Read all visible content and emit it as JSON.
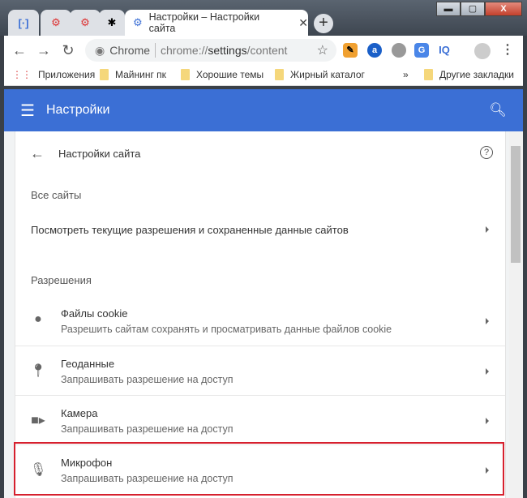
{
  "tabs": [
    {
      "icon": "bracket-icon"
    },
    {
      "icon": "gear-wrench-icon"
    },
    {
      "icon": "gear-wrench-icon"
    },
    {
      "icon": "puzzle-icon"
    },
    {
      "label": "Настройки – Настройки сайта",
      "icon": "settings-gear-icon",
      "active": true
    }
  ],
  "omnibox": {
    "site": "Chrome",
    "url_prefix": "chrome://",
    "url_host": "settings",
    "url_path": "/content"
  },
  "extensions": [
    "IQ"
  ],
  "bookmarks": {
    "apps": "Приложения",
    "items": [
      "Майнинг пк",
      "Хорошие темы",
      "Жирный каталог"
    ],
    "overflow": "»",
    "other": "Другие закладки"
  },
  "header": {
    "title": "Настройки"
  },
  "page": {
    "title": "Настройки сайта",
    "all_sites_heading": "Все сайты",
    "all_sites_link": "Посмотреть текущие разрешения и сохраненные данные сайтов",
    "permissions_heading": "Разрешения"
  },
  "permissions": [
    {
      "label": "Файлы cookie",
      "desc": "Разрешить сайтам сохранять и просматривать данные файлов cookie",
      "icon": "cookie-icon"
    },
    {
      "label": "Геоданные",
      "desc": "Запрашивать разрешение на доступ",
      "icon": "location-pin-icon"
    },
    {
      "label": "Камера",
      "desc": "Запрашивать разрешение на доступ",
      "icon": "camera-icon"
    },
    {
      "label": "Микрофон",
      "desc": "Запрашивать разрешение на доступ",
      "icon": "microphone-icon",
      "highlighted": true
    }
  ],
  "colors": {
    "header": "#3b6fd5",
    "highlight": "#d6202e"
  }
}
